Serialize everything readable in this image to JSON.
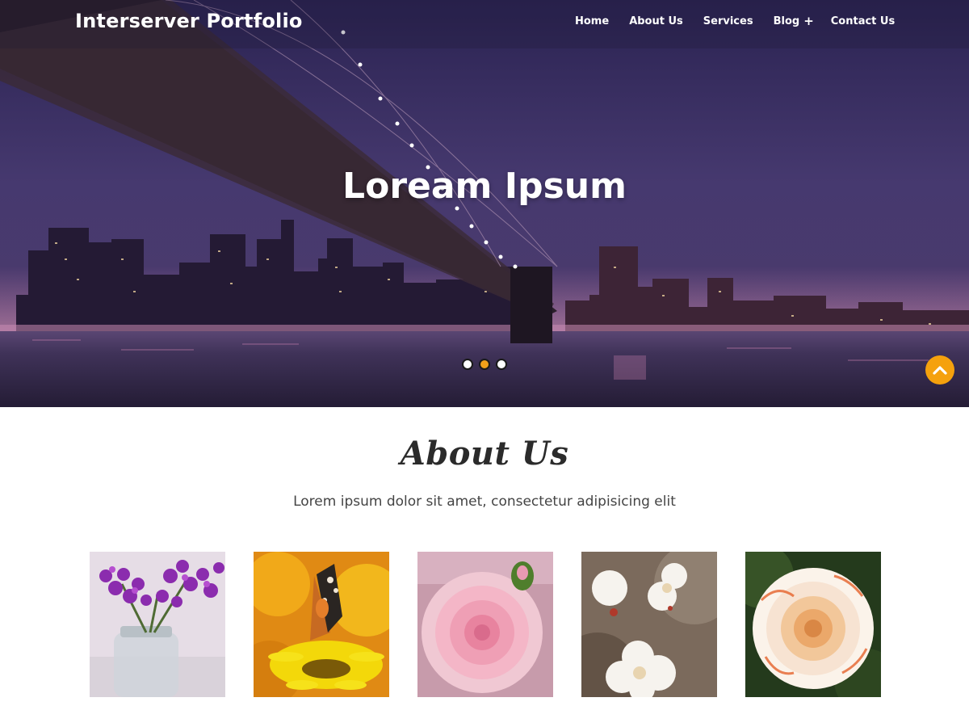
{
  "header": {
    "site_title": "Interserver Portfolio",
    "nav": {
      "home": "Home",
      "about": "About Us",
      "services": "Services",
      "blog": "Blog",
      "blog_expand": "+",
      "contact": "Contact Us"
    }
  },
  "slider": {
    "title": "Loream Ipsum",
    "slide_count": 3,
    "active_slide": 2
  },
  "about": {
    "title": "About Us",
    "text": "Lorem ipsum dolor sit amet, consectetur adipisicing elit"
  },
  "gallery": {
    "images": [
      "purple-hyacinth-image",
      "butterfly-image",
      "pink-rose-image",
      "white-blossom-image",
      "white-orange-rose-image"
    ]
  },
  "colors": {
    "accent": "#f5a10d",
    "hero_sky": "#3a2d63",
    "text_dark": "#2b2b2b"
  },
  "icons": {
    "scroll_top": "chevron-up-icon"
  }
}
